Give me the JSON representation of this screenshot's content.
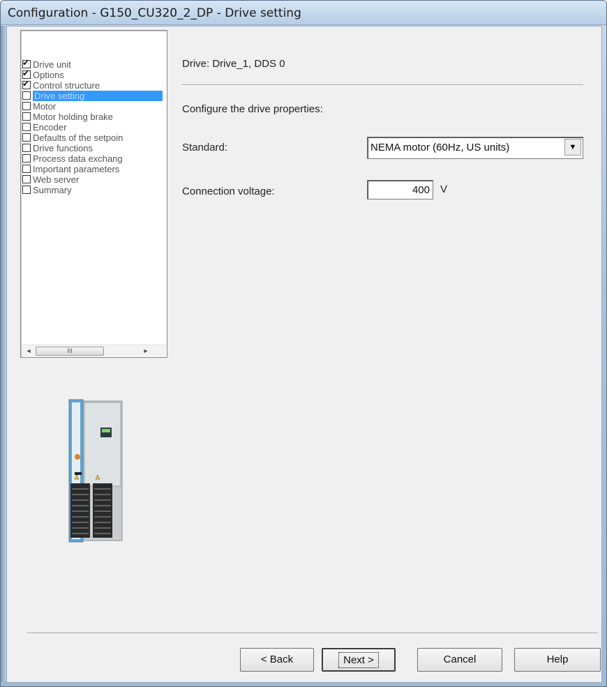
{
  "window": {
    "title": "Configuration - G150_CU320_2_DP - Drive setting"
  },
  "tree": {
    "items": [
      {
        "label": "Drive unit",
        "checked": true,
        "selected": false
      },
      {
        "label": "Options",
        "checked": true,
        "selected": false
      },
      {
        "label": "Control structure",
        "checked": true,
        "selected": false
      },
      {
        "label": "Drive setting",
        "checked": false,
        "selected": true
      },
      {
        "label": "Motor",
        "checked": false,
        "selected": false
      },
      {
        "label": "Motor holding brake",
        "checked": false,
        "selected": false
      },
      {
        "label": "Encoder",
        "checked": false,
        "selected": false
      },
      {
        "label": "Defaults of the setpoin",
        "checked": false,
        "selected": false
      },
      {
        "label": "Drive functions",
        "checked": false,
        "selected": false
      },
      {
        "label": "Process data exchang",
        "checked": false,
        "selected": false
      },
      {
        "label": "Important parameters",
        "checked": false,
        "selected": false
      },
      {
        "label": "Web server",
        "checked": false,
        "selected": false
      },
      {
        "label": "Summary",
        "checked": false,
        "selected": false
      }
    ],
    "scroll_left": "◄",
    "scroll_thumb": "III",
    "scroll_right": "►"
  },
  "main": {
    "drive_header": "Drive: Drive_1, DDS 0",
    "configure_label": "Configure the drive properties:",
    "standard_label": "Standard:",
    "standard_value": "NEMA motor (60Hz, US units)",
    "voltage_label": "Connection voltage:",
    "voltage_value": "400",
    "voltage_unit": "V"
  },
  "buttons": {
    "back": "< Back",
    "next": "Next >",
    "cancel": "Cancel",
    "help": "Help"
  },
  "colors": {
    "selection": "#3399ff",
    "titlebar": "#b6cde6",
    "dialog_bg": "#f0f0f0"
  }
}
